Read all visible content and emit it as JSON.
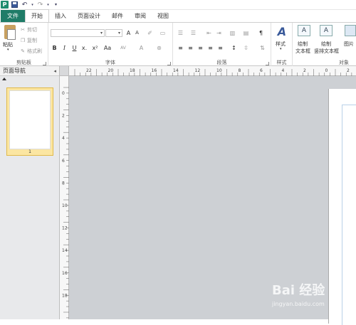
{
  "qat": {
    "app_letter": "P"
  },
  "tabs": [
    "文件",
    "开始",
    "插入",
    "页面设计",
    "邮件",
    "审阅",
    "视图"
  ],
  "clipboard": {
    "paste": "粘贴",
    "cut": "剪切",
    "copy": "复制",
    "format_painter": "格式刷",
    "label": "剪贴板"
  },
  "font": {
    "label": "字体",
    "bold": "B",
    "italic": "I",
    "underline": "U",
    "strike": "x.",
    "superscript": "x²",
    "case": "Aa",
    "grow": "A",
    "shrink": "A",
    "spacing": "AV",
    "color": "A"
  },
  "paragraph": {
    "label": "段落"
  },
  "styles": {
    "label": "样式",
    "button": "样式"
  },
  "objects": {
    "label": "对象",
    "draw_textbox": "绘制文本框",
    "draw_textbox_line1": "绘制",
    "draw_textbox_line2": "文本框",
    "vertical_line1": "绘制",
    "vertical_line2": "竖排文本框",
    "picture": "图片"
  },
  "nav": {
    "title": "页面导航",
    "collapse": "◂",
    "page_number": "1"
  },
  "ruler_h": [
    "22",
    "20",
    "18",
    "16",
    "14",
    "12",
    "10",
    "8",
    "6",
    "4",
    "2",
    "0",
    "2",
    "4",
    "6"
  ],
  "ruler_v": [
    "0",
    "2",
    "4",
    "6",
    "8",
    "10",
    "12",
    "14",
    "16",
    "18",
    "20"
  ],
  "watermark": {
    "logo": "Bai 经验",
    "url": "jingyan.baidu.com"
  },
  "colors": {
    "file_tab": "#1f7c68",
    "accent": "#e0b94a",
    "canvas": "#cdd0d4"
  }
}
